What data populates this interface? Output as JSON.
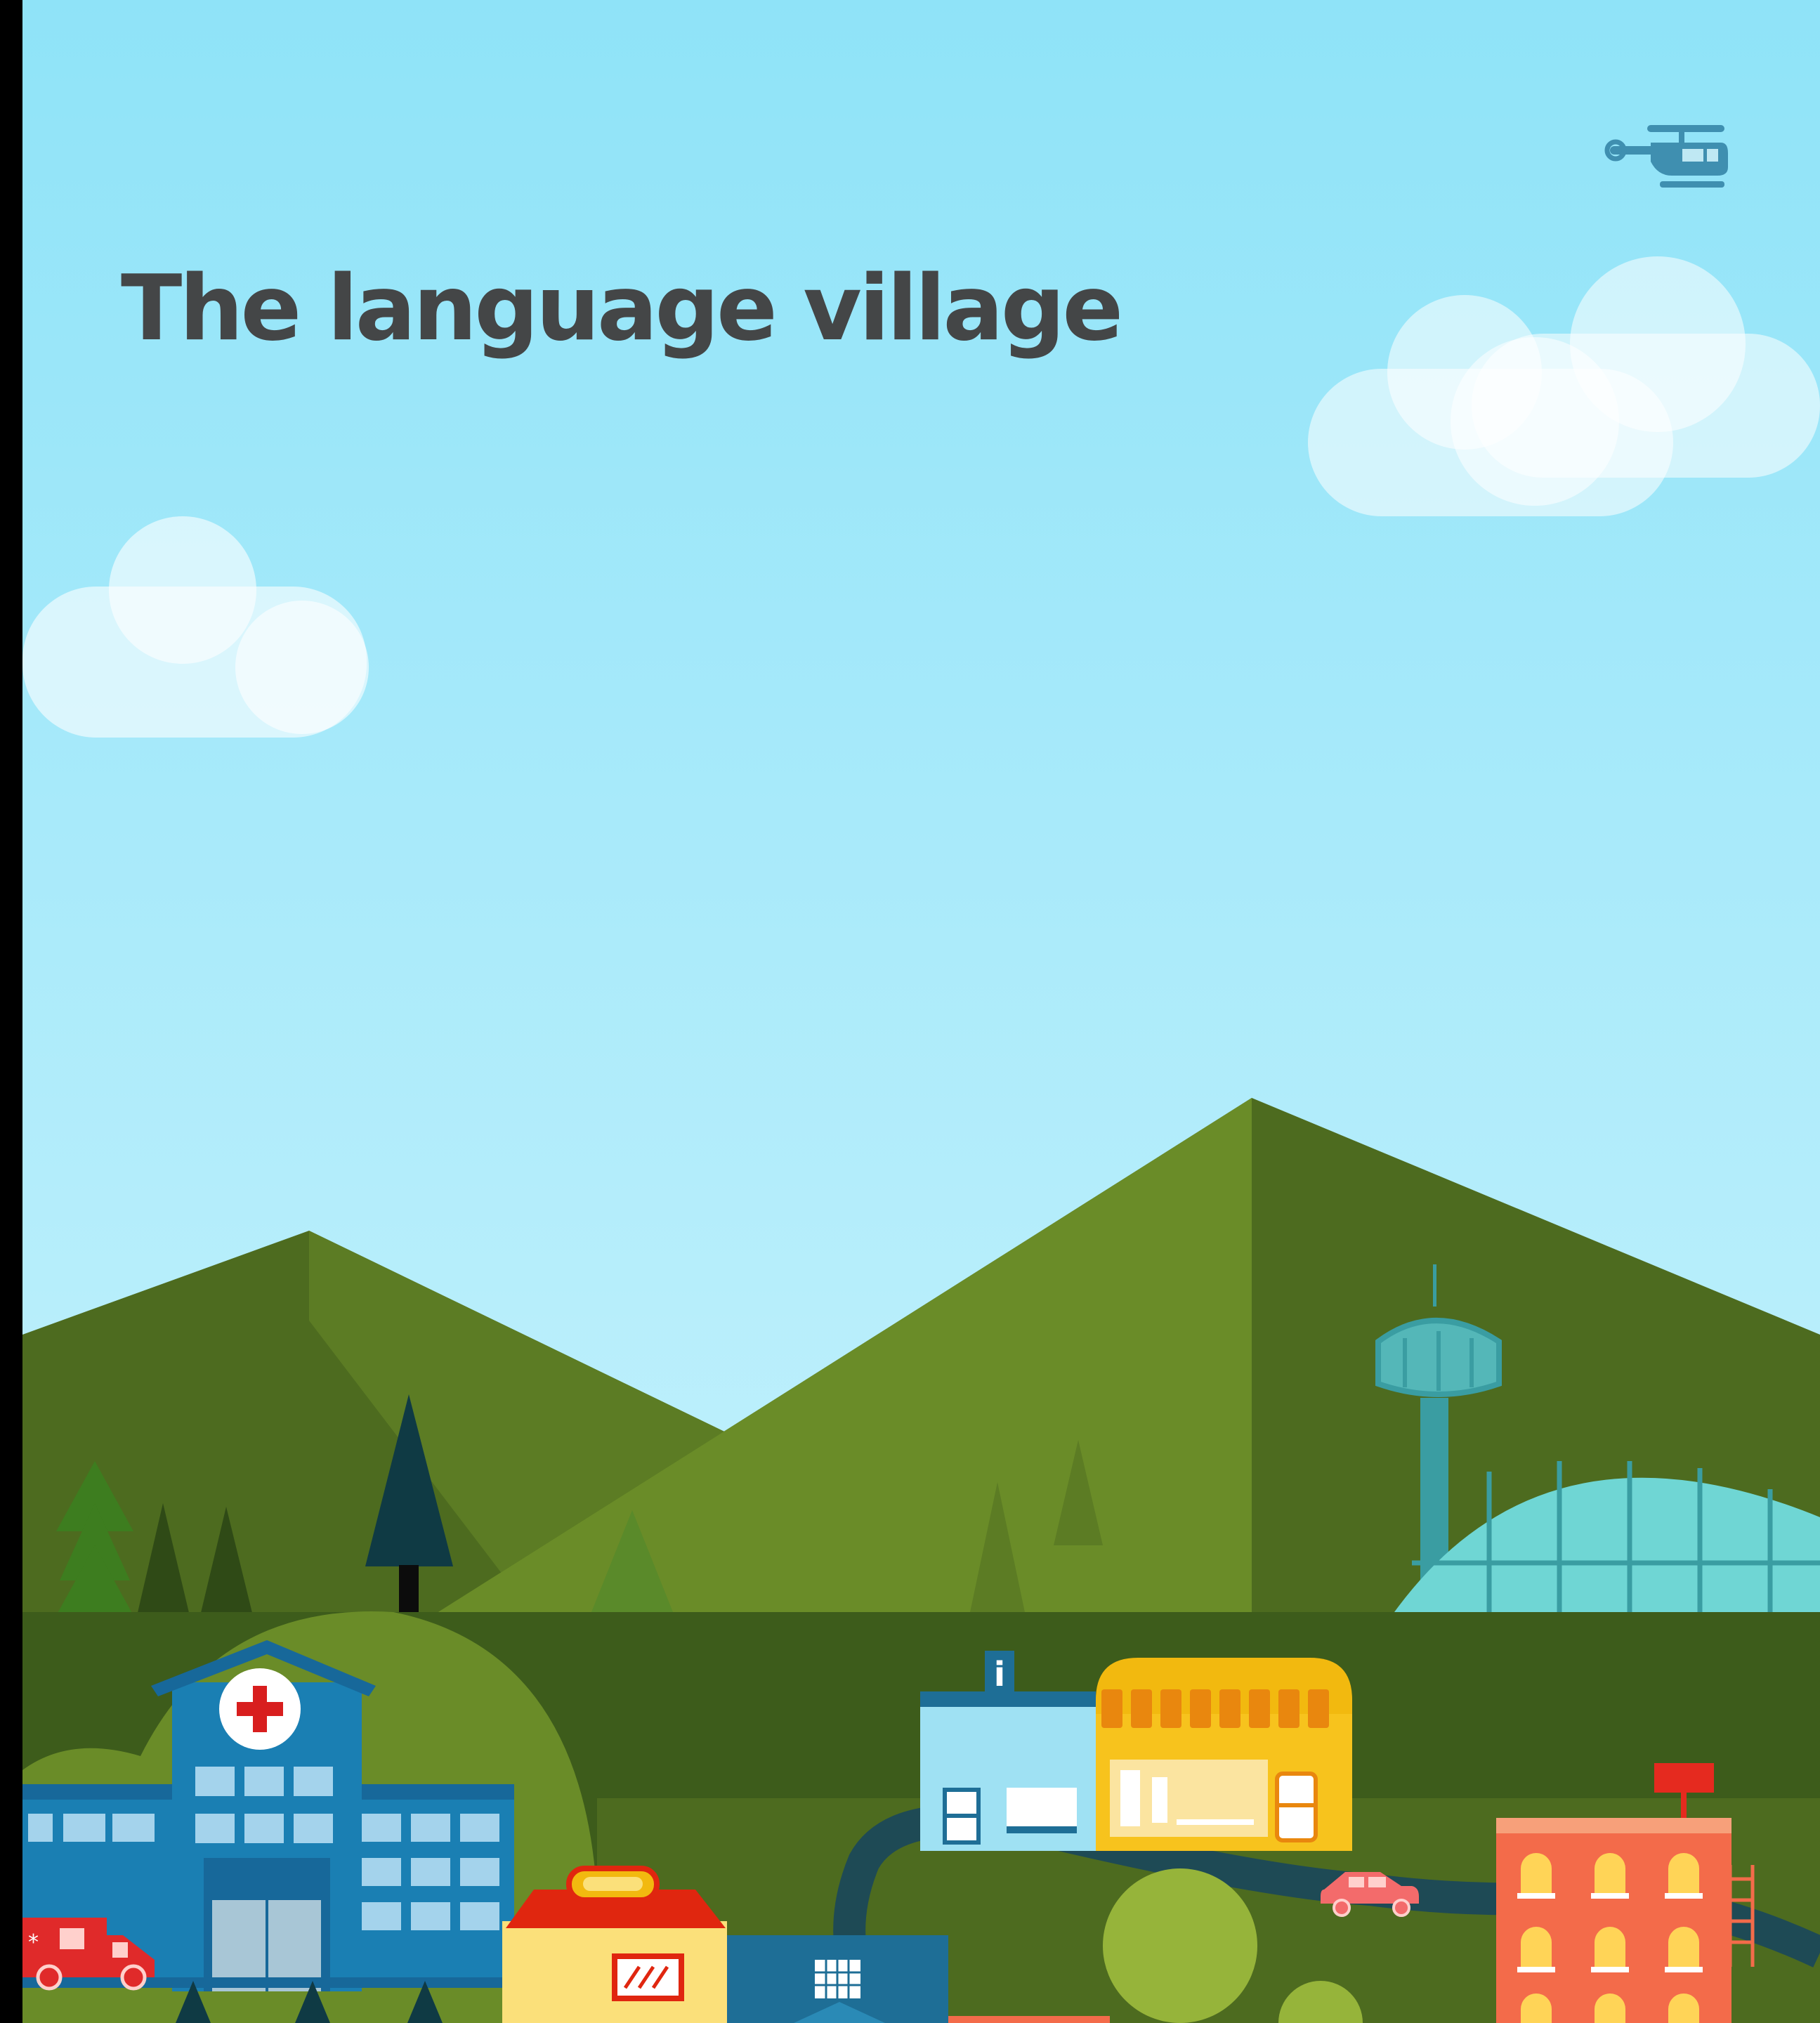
{
  "page": {
    "title": "The language village"
  },
  "colors": {
    "sky_top": "#8fe3f8",
    "sky_bottom": "#c9f3fc",
    "mountain_dark": "#4d6b1f",
    "mountain_light": "#6a8c28",
    "hill_mid": "#3d5c1b",
    "tree_dark": "#0f3a44",
    "road": "#1e4a55",
    "hospital_blue": "#1a7fb3",
    "airport_teal": "#54b7b8",
    "shop_yellow": "#f2b90f",
    "hotel_orange": "#f36b4a",
    "title_text": "#444647"
  },
  "icons": {
    "helicopter": "helicopter-icon",
    "info": "info-icon",
    "cross": "red-cross-icon",
    "car": "car-icon",
    "ambulance": "ambulance-icon"
  },
  "info_sign": "i"
}
